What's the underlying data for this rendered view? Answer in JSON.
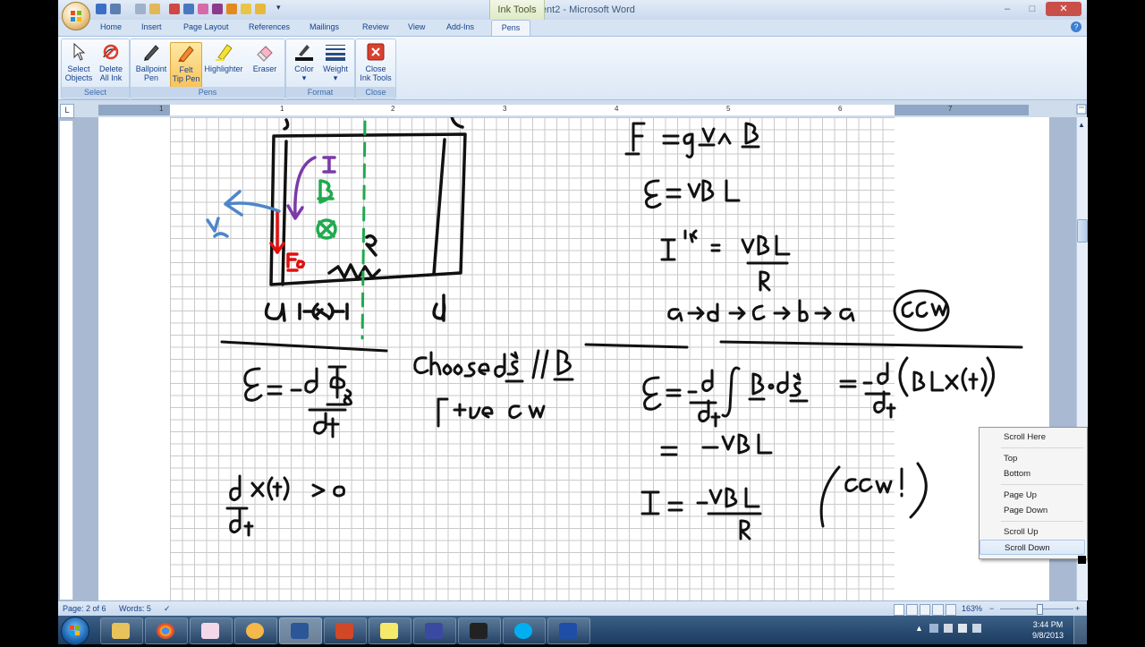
{
  "window": {
    "title": "Document2 - Microsoft Word",
    "contextual_tab_group": "Ink Tools",
    "controls": {
      "minimize": "–",
      "maximize": "□",
      "close": "✕"
    },
    "help": "?"
  },
  "ribbon": {
    "tabs": [
      "Home",
      "Insert",
      "Page Layout",
      "References",
      "Mailings",
      "Review",
      "View",
      "Add-Ins"
    ],
    "active_tab": "Pens",
    "groups": {
      "select": {
        "label": "Select",
        "buttons": [
          {
            "line1": "Select",
            "line2": "Objects"
          },
          {
            "line1": "Delete",
            "line2": "All Ink"
          }
        ]
      },
      "pens": {
        "label": "Pens",
        "buttons": [
          {
            "line1": "Ballpoint",
            "line2": "Pen"
          },
          {
            "line1": "Felt",
            "line2": "Tip Pen"
          },
          {
            "line1": "Highlighter",
            "line2": ""
          },
          {
            "line1": "Eraser",
            "line2": ""
          }
        ]
      },
      "format": {
        "label": "Format",
        "buttons": [
          {
            "line1": "Color",
            "line2": "▾"
          },
          {
            "line1": "Weight",
            "line2": "▾"
          }
        ]
      },
      "close": {
        "label": "Close",
        "buttons": [
          {
            "line1": "Close",
            "line2": "Ink Tools"
          }
        ]
      }
    }
  },
  "ruler": {
    "numbers": [
      "1",
      "1",
      "2",
      "3",
      "4",
      "5",
      "6",
      "7"
    ],
    "corner": "L"
  },
  "status_bar": {
    "page": "Page: 2 of 6",
    "words": "Words: 5",
    "zoom": "163%",
    "zoom_minus": "−",
    "zoom_plus": "+"
  },
  "context_menu": {
    "items": [
      "Scroll Here",
      "Top",
      "Bottom",
      "Page Up",
      "Page Down",
      "Scroll Up",
      "Scroll Down"
    ],
    "highlighted": "Scroll Down"
  },
  "taskbar": {
    "time": "3:44 PM",
    "date": "9/8/2013"
  },
  "colors": {
    "ink_black": "#111111",
    "ink_red": "#e01010",
    "ink_green": "#1faa4e",
    "ink_purple": "#7b3aa8",
    "ink_blue": "#4e86c9",
    "ribbon_active": "#f9c158"
  }
}
